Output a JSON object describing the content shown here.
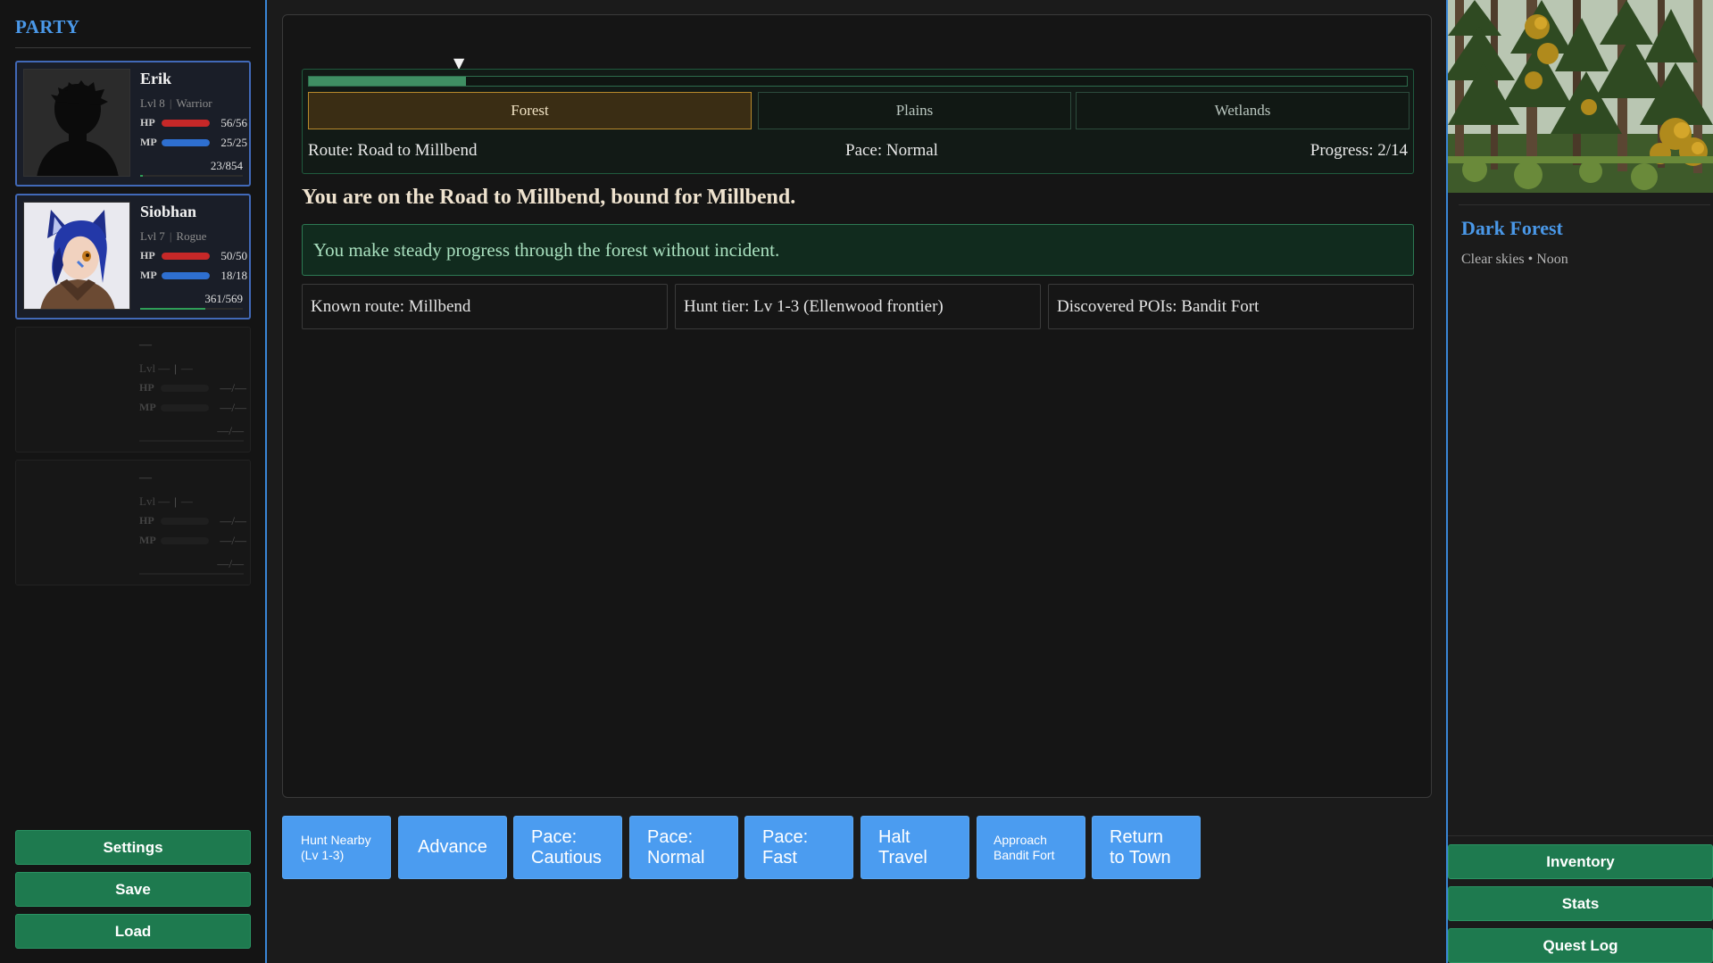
{
  "party": {
    "title": "PARTY",
    "members": [
      {
        "name": "Erik",
        "level": "Lvl 8",
        "class": "Warrior",
        "hp_label": "HP",
        "hp": "56/56",
        "hp_fraction": 1.0,
        "mp_label": "MP",
        "mp": "25/25",
        "mp_fraction": 1.0,
        "xp": "23/854",
        "xp_fraction": 0.027
      },
      {
        "name": "Siobhan",
        "level": "Lvl 7",
        "class": "Rogue",
        "hp_label": "HP",
        "hp": "50/50",
        "hp_fraction": 1.0,
        "mp_label": "MP",
        "mp": "18/18",
        "mp_fraction": 1.0,
        "xp": "361/569",
        "xp_fraction": 0.634
      },
      {
        "name": "—",
        "level": "Lvl —",
        "class": "—",
        "hp_label": "HP",
        "hp": "—/—",
        "hp_fraction": 0,
        "mp_label": "MP",
        "mp": "—/—",
        "mp_fraction": 0,
        "xp": "—/—",
        "xp_fraction": 0
      },
      {
        "name": "—",
        "level": "Lvl —",
        "class": "—",
        "hp_label": "HP",
        "hp": "—/—",
        "hp_fraction": 0,
        "mp_label": "MP",
        "mp": "—/—",
        "mp_fraction": 0,
        "xp": "—/—",
        "xp_fraction": 0
      }
    ]
  },
  "left_buttons": {
    "settings": "Settings",
    "save": "Save",
    "load": "Load"
  },
  "travel": {
    "progress_fraction": 0.143,
    "biomes": [
      "Forest",
      "Plains",
      "Wetlands"
    ],
    "active_biome": "Forest",
    "route": "Route: Road to Millbend",
    "pace": "Pace: Normal",
    "progress": "Progress: 2/14"
  },
  "headline": "You are on the Road to Millbend, bound for Millbend.",
  "event_message": "You make steady progress through the forest without incident.",
  "info": {
    "known_route": "Known route: Millbend",
    "hunt_tier": "Hunt tier: Lv 1-3 (Ellenwood frontier)",
    "pois": "Discovered POIs: Bandit Fort"
  },
  "actions": {
    "hunt": "Hunt Nearby\n(Lv 1-3)",
    "advance": "Advance",
    "pace_cautious": "Pace:\nCautious",
    "pace_normal": "Pace:\nNormal",
    "pace_fast": "Pace:\nFast",
    "halt": "Halt\nTravel",
    "approach": "Approach\nBandit Fort",
    "return": "Return\nto Town"
  },
  "location": {
    "name": "Dark Forest",
    "conditions": "Clear skies • Noon"
  },
  "right_buttons": {
    "inventory": "Inventory",
    "stats": "Stats",
    "quest_log": "Quest Log"
  },
  "colors": {
    "accent_blue": "#4a98e8",
    "green_button": "#1e7a4f",
    "action_blue": "#4b9cf0",
    "hp_red": "#c62828",
    "mp_blue": "#2e6fd0",
    "active_tab_gold": "#b7892c"
  }
}
